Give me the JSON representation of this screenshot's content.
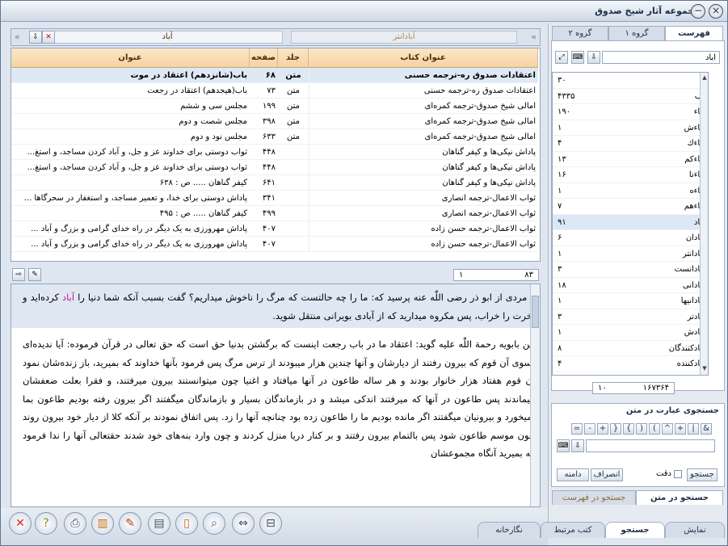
{
  "window": {
    "title": "مجموعه آثار شیخ صدوق"
  },
  "colors": {
    "highlight": "#c0189a",
    "header_bg": "#f4d3a4",
    "selected_row": "#dfe9f6"
  },
  "index_panel": {
    "tabs": [
      "فهرست",
      "گروه ۱",
      "گروه ۲"
    ],
    "search_value": "آباد",
    "items": [
      {
        "word": "آ",
        "count": "۳۰"
      },
      {
        "word": "آب",
        "count": "۴۳۳۵"
      },
      {
        "word": "آباء",
        "count": "۱۹۰"
      },
      {
        "word": "آباءش",
        "count": "۱"
      },
      {
        "word": "آباءك",
        "count": "۴"
      },
      {
        "word": "آباءكم",
        "count": "۱۳"
      },
      {
        "word": "آباءنا",
        "count": "۱۶"
      },
      {
        "word": "آباءه",
        "count": "۱"
      },
      {
        "word": "آباءهم",
        "count": "۷"
      },
      {
        "word": "آباد",
        "count": "۹۱"
      },
      {
        "word": "آبادان",
        "count": "۶"
      },
      {
        "word": "آبادانتر",
        "count": "۱"
      },
      {
        "word": "آبادانست",
        "count": "۳"
      },
      {
        "word": "آبادانی",
        "count": "۱۸"
      },
      {
        "word": "آبادانیها",
        "count": "۱"
      },
      {
        "word": "آبادتر",
        "count": "۳"
      },
      {
        "word": "آبادش",
        "count": "۱"
      },
      {
        "word": "آبادکنندگان",
        "count": "۸"
      },
      {
        "word": "آبادکننده",
        "count": "۴"
      }
    ],
    "position": "۱۰",
    "total": "۱۶۷۳۶۴"
  },
  "text_search_panel": {
    "title": "جستجوی عبارت در متن",
    "operators": [
      "&",
      "|",
      "+",
      "^",
      "(",
      ")",
      "{",
      "}",
      "+",
      "-",
      "="
    ],
    "search_button": "جستجو",
    "precise_label": "دقت",
    "insert_button": "انصراف",
    "range_button": "دامنه",
    "bottom_tabs": [
      "جستجو در متن",
      "جستجو در فهرست"
    ]
  },
  "results": {
    "search_word": "آباد",
    "right_tab": "آبادانتر",
    "headers": {
      "book": "عنوان کتاب",
      "vol": "جلد",
      "page": "صفحه",
      "title": "عنوان"
    },
    "rows": [
      {
        "book": "اعتقادات صدوق ره-ترجمه حسنی",
        "vol": "متن",
        "page": "۶۸",
        "title": "باب(شانزدهم) اعتقاد در موت",
        "bold": true
      },
      {
        "book": "اعتقادات صدوق ره-ترجمه حسنی",
        "vol": "متن",
        "page": "۷۳",
        "title": "باب(هیجدهم) اعتقاد در رجعت"
      },
      {
        "book": "امالی شیخ صدوق-ترجمه کمره‌ای",
        "vol": "متن",
        "page": "۱۹۹",
        "title": "مجلس سی و ششم"
      },
      {
        "book": "امالی شیخ صدوق-ترجمه کمره‌ای",
        "vol": "متن",
        "page": "۳۹۸",
        "title": "مجلس شصت و دوم"
      },
      {
        "book": "امالی شیخ صدوق-ترجمه کمره‌ای",
        "vol": "متن",
        "page": "۶۳۳",
        "title": "مجلس نود و دوم"
      },
      {
        "book": "پاداش نیکی‌ها و کیفر گناهان",
        "vol": "",
        "page": "۴۴۸",
        "title": "ثواب دوستی برای خداوند عز و جل، و آباد کردن مساجد، و استغ..."
      },
      {
        "book": "پاداش نیکی‌ها و کیفر گناهان",
        "vol": "",
        "page": "۴۴۸",
        "title": "ثواب دوستی برای خداوند عز و جل، و آباد کردن مساجد، و استغ..."
      },
      {
        "book": "پاداش نیکی‌ها و کیفر گناهان",
        "vol": "",
        "page": "۶۴۱",
        "title": "کیفر گناهان ..... ص : ۶۳۸"
      },
      {
        "book": "ثواب الاعمال-ترجمه انصاری",
        "vol": "",
        "page": "۳۴۱",
        "title": "پاداش دوستی برای خدا، و تعمیر مساجد، و استغفار در سحرگاها ..."
      },
      {
        "book": "ثواب الاعمال-ترجمه انصاری",
        "vol": "",
        "page": "۴۹۹",
        "title": "کیفر گناهان ..... ص : ۴۹۵"
      },
      {
        "book": "ثواب الاعمال-ترجمه حسن زاده",
        "vol": "",
        "page": "۴۰۷",
        "title": "پاداش مهرورزی به یک دیگر در راه خدای گرامی و بزرگ و آباد ..."
      },
      {
        "book": "ثواب الاعمال-ترجمه حسن زاده",
        "vol": "",
        "page": "۴۰۷",
        "title": "پاداش مهرورزی به یک دیگر در راه خدای گرامی و بزرگ و آباد ..."
      }
    ],
    "position": "۱",
    "total": "۸۳"
  },
  "text": {
    "para1_before": "و مردی از ابو ذر رضی اللّٰه عنه پرسید که: ما را چه حالتست که مرگ را ناخوش میداریم؟ گفت بسبب آنکه شما دنیا را ",
    "para1_highlight": "آباد",
    "para1_after": " کرده‌اید و آخرت را خراب، پس مکروه میدارید که از آبادی بویرانی منتقل شوید.",
    "para2": "ابن بابویه رحمة اللّٰه علیه گوید: اعتقاد ما در باب رجعت اینست که برگشتن بدنیا حق است که حق تعالی در قرآن فرموده: آیا ندیده‌ای بسوی آن قوم که بیرون رفتند از دیارشان و آنها چندین هزار میبودند از ترس مرگ پس فرمود بآنها خداوند که بمیرید، باز زنده‌شان نمود آن قوم هفتاد هزار خانوار بودند و هر ساله طاعون در آنها میافتاد و اغنیا چون میتوانستند بیرون میرفتند، و فقرا بعلت ضعفشان میماندند پس طاعون در آنها که میرفتند اندکی میشد و در بازماندگان بسیار و بازماندگان میگفتند اگر بیرون رفته بودیم طاعون بما نمیخورد و بیرونیان میگفتند اگر مانده بودیم ما را طاعون زده بود چنانچه آنها را زد. پس اتفاق نمودند بر آنکه کلا از دیار خود بیرون روند چون موسم طاعون شود پس بالتمام بیرون رفتند و بر کنار دریا منزل کردند و چون وارد بنه‌های خود شدند حقتعالی آنها را ندا فرمود که بمیرید آنگاه مجموعشان"
  },
  "bottom_tabs": [
    "نمایش",
    "جستجو",
    "کتب مرتبط",
    "نگارخانه"
  ],
  "toolbar_icons": [
    "close-icon",
    "help-icon",
    "print-icon",
    "books-icon",
    "edit-icon",
    "notes-icon",
    "page-icon",
    "zoom-icon",
    "compare-icon",
    "split-icon"
  ]
}
